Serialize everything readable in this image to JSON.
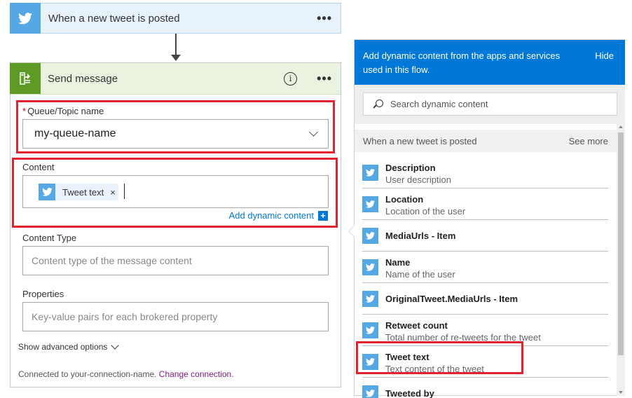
{
  "trigger": {
    "title": "When a new tweet is posted",
    "menu": "•••"
  },
  "action": {
    "title": "Send message",
    "info": "i",
    "menu": "•••",
    "queue": {
      "required": "*",
      "label": "Queue/Topic name",
      "value": "my-queue-name"
    },
    "content": {
      "label": "Content",
      "token": {
        "label": "Tweet text",
        "remove": "×"
      },
      "add_dynamic": "Add dynamic content",
      "add_icon": "+"
    },
    "content_type": {
      "label": "Content Type",
      "placeholder": "Content type of the message content"
    },
    "properties": {
      "label": "Properties",
      "placeholder": "Key-value pairs for each brokered property"
    },
    "show_advanced": "Show advanced options",
    "connection": {
      "text": "Connected to your-connection-name.",
      "link": "Change connection."
    }
  },
  "panel": {
    "description": "Add dynamic content from the apps and services used in this flow.",
    "hide": "Hide",
    "search_placeholder": "Search dynamic content",
    "group": {
      "title": "When a new tweet is posted",
      "see_more": "See more"
    },
    "items": [
      {
        "name": "Description",
        "sub": "User description"
      },
      {
        "name": "Location",
        "sub": "Location of the user"
      },
      {
        "name": "MediaUrls - Item",
        "sub": ""
      },
      {
        "name": "Name",
        "sub": "Name of the user"
      },
      {
        "name": "OriginalTweet.MediaUrls - Item",
        "sub": ""
      },
      {
        "name": "Retweet count",
        "sub": "Total number of re-tweets for the tweet"
      },
      {
        "name": "Tweet text",
        "sub": "Text content of the tweet"
      },
      {
        "name": "Tweeted by",
        "sub": ""
      }
    ]
  },
  "colors": {
    "twitter": "#56a8e5",
    "service_bus": "#5d9b26",
    "panel_header": "#0078d7",
    "highlight": "#e0232e",
    "link": "#0078d4"
  }
}
